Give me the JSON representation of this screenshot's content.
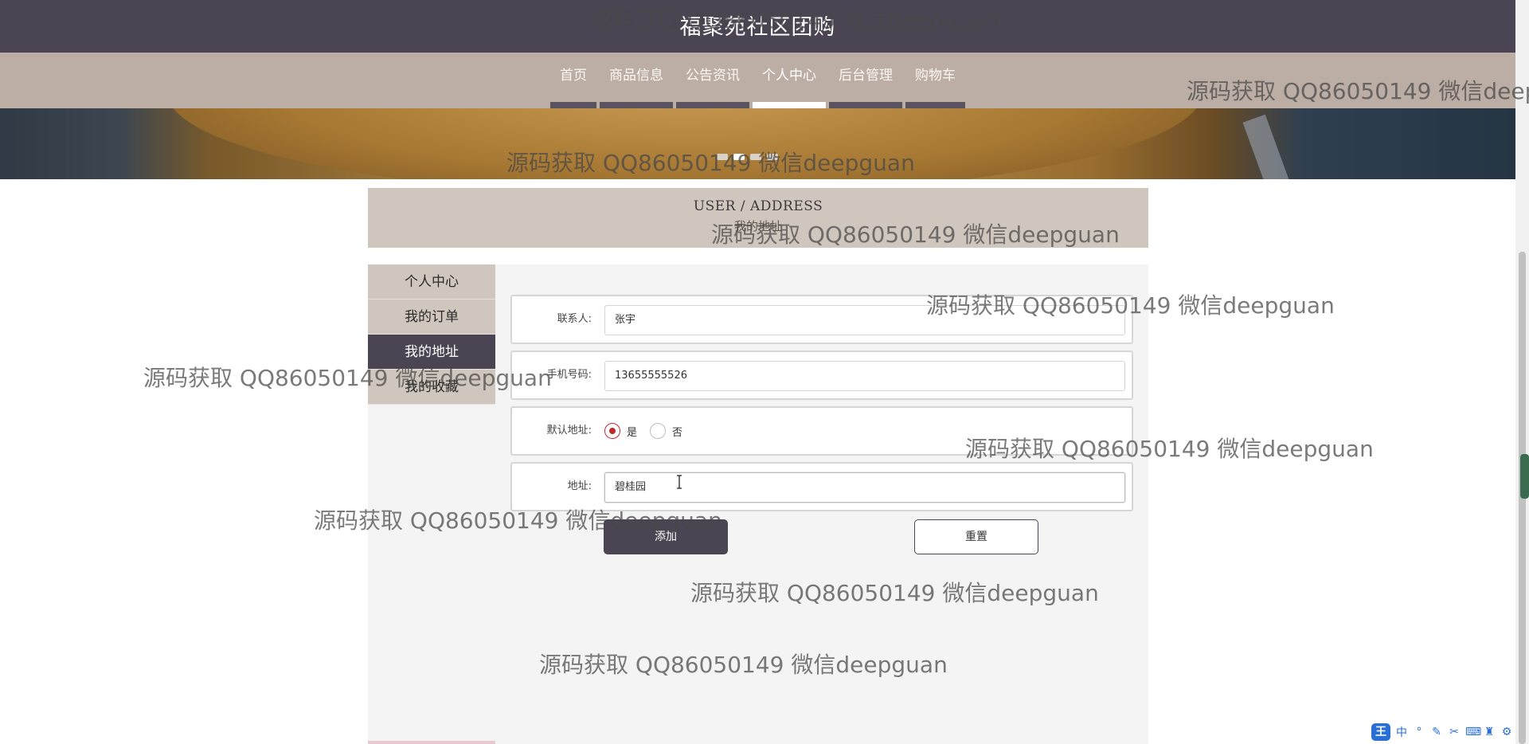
{
  "header": {
    "title": "福聚苑社区团购"
  },
  "nav": {
    "items": [
      {
        "label": "首页"
      },
      {
        "label": "商品信息"
      },
      {
        "label": "公告资讯"
      },
      {
        "label": "个人中心"
      },
      {
        "label": "后台管理"
      },
      {
        "label": "购物车"
      }
    ],
    "active_index": 3
  },
  "breadcrumb": {
    "title": "USER / ADDRESS",
    "subtitle": "我的地址"
  },
  "sidebar": {
    "items": [
      {
        "label": "个人中心"
      },
      {
        "label": "我的订单"
      },
      {
        "label": "我的地址"
      },
      {
        "label": "我的收藏"
      }
    ],
    "active_index": 2
  },
  "form": {
    "contact": {
      "label": "联系人:",
      "value": "张宇"
    },
    "phone": {
      "label": "手机号码:",
      "value": "13655555526"
    },
    "default": {
      "label": "默认地址:",
      "yes": "是",
      "no": "否",
      "selected": "是"
    },
    "address": {
      "label": "地址:",
      "value": "碧桂园"
    },
    "add_button": "添加",
    "reset_button": "重置"
  },
  "watermark": "源码获取 QQ86050149 微信deepguan",
  "ime": {
    "logo": "王",
    "mode": "中"
  },
  "colors": {
    "header_bg": "#4b4452",
    "nav_bg": "#bcaea4",
    "crumb_bg": "#cfc6bd",
    "accent_radio": "#c0282d",
    "content_bg": "#f4f4f4"
  }
}
